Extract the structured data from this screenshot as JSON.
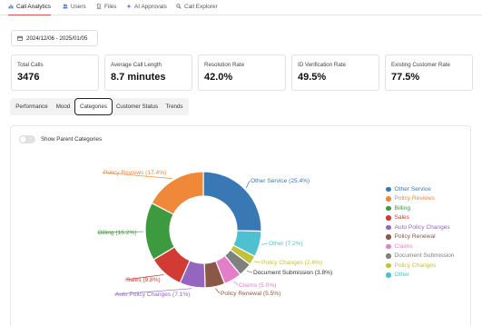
{
  "nav": {
    "tabs": [
      {
        "label": "Call Analytics",
        "icon": "bar-chart-icon",
        "active": true
      },
      {
        "label": "Users",
        "icon": "users-icon",
        "active": false
      },
      {
        "label": "Files",
        "icon": "file-icon",
        "active": false
      },
      {
        "label": "AI Approvals",
        "icon": "sparkle-icon",
        "active": false
      },
      {
        "label": "Call Explorer",
        "icon": "search-icon",
        "active": false
      }
    ]
  },
  "date_range": "2024/12/06 - 2025/01/05",
  "metrics": [
    {
      "label": "Total Calls",
      "value": "3476"
    },
    {
      "label": "Average Call Length",
      "value": "8.7 minutes"
    },
    {
      "label": "Resolution Rate",
      "value": "42.0%"
    },
    {
      "label": "ID Verification Rate",
      "value": "49.5%"
    },
    {
      "label": "Existing Customer Rate",
      "value": "77.5%"
    }
  ],
  "view_tabs": [
    {
      "label": "Performance",
      "active": false
    },
    {
      "label": "Mood",
      "active": false
    },
    {
      "label": "Categories",
      "active": true
    },
    {
      "label": "Customer Status",
      "active": false
    },
    {
      "label": "Trends",
      "active": false
    }
  ],
  "toggle": {
    "label": "Show Parent Categories",
    "on": false
  },
  "chart_data": {
    "type": "pie",
    "donut": true,
    "slices": [
      {
        "name": "Other Service",
        "value": 25.4,
        "label": "Other Service (25.4%)",
        "color": "#3a78b5"
      },
      {
        "name": "Other",
        "value": 7.2,
        "label": "Other (7.2%)",
        "color": "#4fc0cf"
      },
      {
        "name": "Policy Changes",
        "value": 2.6,
        "label": "Policy Changes (2.6%)",
        "color": "#c2c13a"
      },
      {
        "name": "Document Submission",
        "value": 3.8,
        "label": "Document Submission (3.8%)",
        "color": "#808080"
      },
      {
        "name": "Claims",
        "value": 5.0,
        "label": "Claims (5.0%)",
        "color": "#e67dc8"
      },
      {
        "name": "Policy Renewal",
        "value": 5.5,
        "label": "Policy Renewal (5.5%)",
        "color": "#8b5847"
      },
      {
        "name": "Auto Policy Changes",
        "value": 7.1,
        "label": "Auto Policy Changes (7.1%)",
        "color": "#9466c0"
      },
      {
        "name": "Sales",
        "value": 9.8,
        "label": "Sales (9.8%)",
        "color": "#d23b33"
      },
      {
        "name": "Billing",
        "value": 16.2,
        "label": "Billing (16.2%)",
        "color": "#3e9a3e"
      },
      {
        "name": "Policy Reviews",
        "value": 17.4,
        "label": "Policy Reviews (17.4%)",
        "color": "#f0883a"
      }
    ],
    "legend": [
      "Other Service",
      "Policy Reviews",
      "Billing",
      "Sales",
      "Auto Policy Changes",
      "Policy Renewal",
      "Claims",
      "Document Submission",
      "Policy Changes",
      "Other"
    ],
    "legend_position": "right"
  }
}
